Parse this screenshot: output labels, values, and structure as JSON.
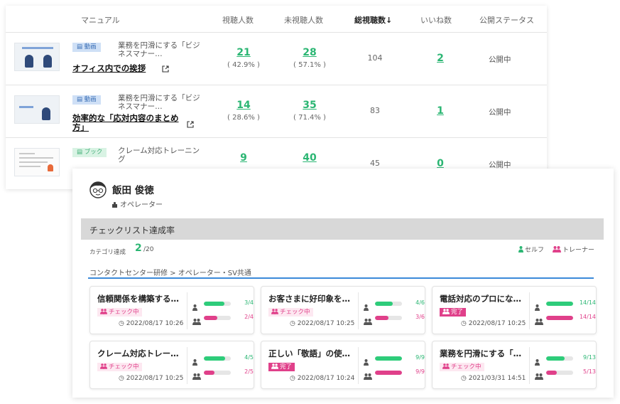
{
  "manual_table": {
    "headers": {
      "manual": "マニュアル",
      "viewers": "視聴人数",
      "non_viewers": "未視聴人数",
      "total_views": "総視聴数↓",
      "likes": "いいね数",
      "status": "公開ステータス"
    },
    "rows": [
      {
        "type": "動画",
        "course": "業務を円滑にする「ビジネスマナー…",
        "title": "オフィス内での挨拶",
        "viewers": "21",
        "viewers_pct": "( 42.9% )",
        "non_viewers": "28",
        "non_viewers_pct": "( 57.1% )",
        "total_views": "104",
        "likes": "2",
        "status": "公開中"
      },
      {
        "type": "動画",
        "course": "業務を円滑にする「ビジネスマナー…",
        "title": "効率的な「応対内容のまとめ方」",
        "viewers": "14",
        "viewers_pct": "( 28.6% )",
        "non_viewers": "35",
        "non_viewers_pct": "( 71.4% )",
        "total_views": "83",
        "likes": "1",
        "status": "公開中"
      },
      {
        "type": "ブック",
        "course": "クレーム対応トレーニング",
        "title": "",
        "viewers": "9",
        "viewers_pct": "",
        "non_viewers": "40",
        "non_viewers_pct": "",
        "total_views": "45",
        "likes": "0",
        "status": "公開中"
      }
    ]
  },
  "user": {
    "name": "飯田 俊徳",
    "role": "オペレーター"
  },
  "checklist": {
    "section_title": "チェックリスト達成率",
    "category_label": "カテゴリ達成",
    "category_value": "2",
    "category_total": "/20",
    "legend_self": "セルフ",
    "legend_trainer": "トレーナー",
    "breadcrumb": "コンタクトセンター研修 > オペレーター・SV共通",
    "cards": [
      {
        "title": "信頼関係を構築する…",
        "status": "チェック中",
        "status_kind": "progress",
        "date": "2022/08/17 10:26",
        "self": "3/4",
        "self_ratio": 0.75,
        "trainer": "2/4",
        "trainer_ratio": 0.5
      },
      {
        "title": "お客さまに好印象を…",
        "status": "チェック中",
        "status_kind": "progress",
        "date": "2022/08/17 10:25",
        "self": "4/6",
        "self_ratio": 0.667,
        "trainer": "3/6",
        "trainer_ratio": 0.5
      },
      {
        "title": "電話対応のプロにな…",
        "status": "完了",
        "status_kind": "done",
        "date": "2022/08/17 10:25",
        "self": "14/14",
        "self_ratio": 1.0,
        "trainer": "14/14",
        "trainer_ratio": 1.0
      },
      {
        "title": "クレーム対応トレー…",
        "status": "チェック中",
        "status_kind": "progress",
        "date": "2022/08/17 10:25",
        "self": "4/5",
        "self_ratio": 0.8,
        "trainer": "2/5",
        "trainer_ratio": 0.4
      },
      {
        "title": "正しい「敬語」の使…",
        "status": "完了",
        "status_kind": "done",
        "date": "2022/08/17 10:24",
        "self": "9/9",
        "self_ratio": 1.0,
        "trainer": "9/9",
        "trainer_ratio": 1.0
      },
      {
        "title": "業務を円滑にする「…",
        "status": "チェック中",
        "status_kind": "progress",
        "date": "2021/03/31 14:51",
        "self": "9/13",
        "self_ratio": 0.692,
        "trainer": "5/13",
        "trainer_ratio": 0.385
      }
    ]
  },
  "colors": {
    "accent_green": "#2bb673",
    "accent_pink": "#e0408a",
    "link_blue": "#3b8ad9"
  }
}
